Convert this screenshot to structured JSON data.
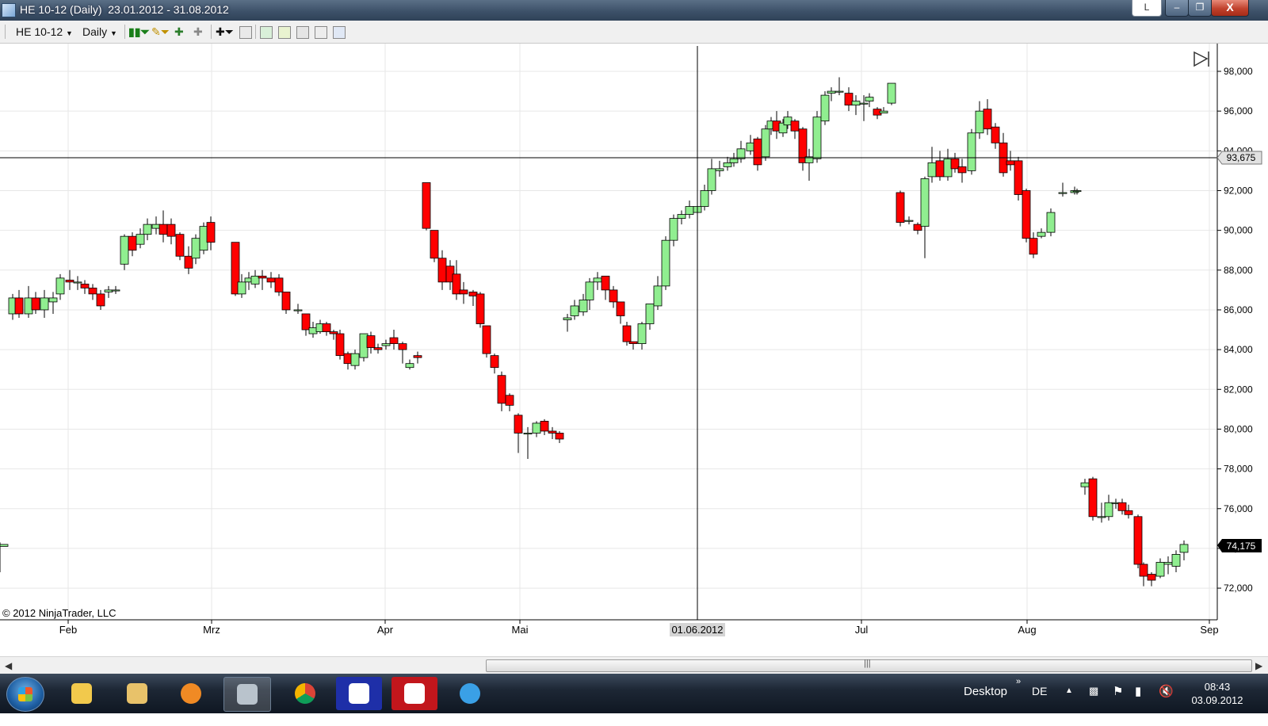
{
  "window": {
    "title": "HE 10-12 (Daily)  23.01.2012 - 31.08.2012",
    "l_button": "L",
    "minimize_label": "–",
    "maximize_label": "❐",
    "close_label": "X"
  },
  "toolbar": {
    "instrument": "HE 10-12",
    "interval": "Daily"
  },
  "chart": {
    "copyright": "© 2012 NinjaTrader, LLC",
    "crosshair_date": "01.06.2012",
    "crosshair_price": "93,675",
    "last_price": "74,175",
    "y_ticks": [
      "98,000",
      "96,000",
      "94,000",
      "92,000",
      "90,000",
      "88,000",
      "86,000",
      "84,000",
      "82,000",
      "80,000",
      "78,000",
      "76,000",
      "74,000",
      "72,000"
    ],
    "x_ticks": [
      "Feb",
      "Mrz",
      "Apr",
      "Mai",
      "Jul",
      "Aug",
      "Sep"
    ],
    "up_color": "#90ee90",
    "down_color": "#ff0000"
  },
  "chart_data": {
    "type": "candlestick",
    "ylim": [
      71.2,
      99.5
    ],
    "candles": [
      [
        85.8,
        86.6,
        85.5,
        86.8
      ],
      [
        86.6,
        85.8,
        85.6,
        87.0
      ],
      [
        85.8,
        86.6,
        85.6,
        87.2
      ],
      [
        86.6,
        86.0,
        85.8,
        86.9
      ],
      [
        86.0,
        86.6,
        85.6,
        87.0
      ],
      [
        86.4,
        86.6,
        85.8,
        86.9
      ],
      [
        86.8,
        87.6,
        86.5,
        87.8
      ],
      [
        87.5,
        87.4,
        87.0,
        88.0
      ],
      [
        87.4,
        87.4,
        87.0,
        87.7
      ],
      [
        87.3,
        87.1,
        86.8,
        87.5
      ],
      [
        87.1,
        86.8,
        86.5,
        87.3
      ],
      [
        86.8,
        86.2,
        86.0,
        87.0
      ],
      [
        86.9,
        87.0,
        86.6,
        87.2
      ],
      [
        87.0,
        87.0,
        86.8,
        87.2
      ],
      [
        88.3,
        89.7,
        88.0,
        89.8
      ],
      [
        89.7,
        89.0,
        88.7,
        89.9
      ],
      [
        89.3,
        89.8,
        89.1,
        90.1
      ],
      [
        89.8,
        90.3,
        89.5,
        90.6
      ],
      [
        90.1,
        90.3,
        89.8,
        90.7
      ],
      [
        90.3,
        89.8,
        89.4,
        91.0
      ],
      [
        90.3,
        89.7,
        89.3,
        90.6
      ],
      [
        89.8,
        88.7,
        88.5,
        89.9
      ],
      [
        88.7,
        88.1,
        87.8,
        89.2
      ],
      [
        88.6,
        89.6,
        88.3,
        89.8
      ],
      [
        89.0,
        90.2,
        88.8,
        90.4
      ],
      [
        90.4,
        89.4,
        89.0,
        90.7
      ],
      [
        89.4,
        86.8,
        86.7,
        89.4
      ],
      [
        86.8,
        87.4,
        86.6,
        87.8
      ],
      [
        87.4,
        87.6,
        87.0,
        87.9
      ],
      [
        87.3,
        87.7,
        87.1,
        88.0
      ],
      [
        87.7,
        87.6,
        87.0,
        88.0
      ],
      [
        87.6,
        87.4,
        87.1,
        87.9
      ],
      [
        87.6,
        86.9,
        86.7,
        87.8
      ],
      [
        86.9,
        86.0,
        85.8,
        86.9
      ],
      [
        86.0,
        86.0,
        85.8,
        86.3
      ],
      [
        85.8,
        85.0,
        84.7,
        85.8
      ],
      [
        84.8,
        85.1,
        84.6,
        85.4
      ],
      [
        84.9,
        85.3,
        84.8,
        85.5
      ],
      [
        85.3,
        84.9,
        84.7,
        85.4
      ],
      [
        84.9,
        84.8,
        84.5,
        85.0
      ],
      [
        84.8,
        83.7,
        83.5,
        85.0
      ],
      [
        83.8,
        83.3,
        83.0,
        83.9
      ],
      [
        83.2,
        83.8,
        83.0,
        84.0
      ],
      [
        83.6,
        84.8,
        83.4,
        84.8
      ],
      [
        84.7,
        84.1,
        83.8,
        84.9
      ],
      [
        84.1,
        84.0,
        83.8,
        84.3
      ],
      [
        84.2,
        84.3,
        84.0,
        84.5
      ],
      [
        84.6,
        84.3,
        84.0,
        85.0
      ],
      [
        84.3,
        84.0,
        83.3,
        84.4
      ],
      [
        83.1,
        83.3,
        83.0,
        83.5
      ],
      [
        83.7,
        83.6,
        83.3,
        83.9
      ],
      [
        92.4,
        90.1,
        90.0,
        92.4
      ],
      [
        90.0,
        88.6,
        88.4,
        90.0
      ],
      [
        88.6,
        87.4,
        87.0,
        89.0
      ],
      [
        88.2,
        87.4,
        87.0,
        88.5
      ],
      [
        87.8,
        86.8,
        86.5,
        88.5
      ],
      [
        87.0,
        86.8,
        86.3,
        87.4
      ],
      [
        86.9,
        86.7,
        86.2,
        87.0
      ],
      [
        86.8,
        85.3,
        85.1,
        86.9
      ],
      [
        85.2,
        83.8,
        83.6,
        85.2
      ],
      [
        83.7,
        83.1,
        82.8,
        83.8
      ],
      [
        82.7,
        81.3,
        80.9,
        82.9
      ],
      [
        81.7,
        81.2,
        80.9,
        81.8
      ],
      [
        80.7,
        79.8,
        78.8,
        80.8
      ],
      [
        79.8,
        79.8,
        78.5,
        80.1
      ],
      [
        79.8,
        80.3,
        79.6,
        80.4
      ],
      [
        80.4,
        79.9,
        79.7,
        80.5
      ],
      [
        79.9,
        79.8,
        79.5,
        80.1
      ],
      [
        79.8,
        79.5,
        79.3,
        79.9
      ],
      [
        85.5,
        85.6,
        84.9,
        85.8
      ],
      [
        85.7,
        86.2,
        85.5,
        86.5
      ],
      [
        85.9,
        86.5,
        85.7,
        86.8
      ],
      [
        86.5,
        87.4,
        86.0,
        87.6
      ],
      [
        87.4,
        87.6,
        87.0,
        87.9
      ],
      [
        87.7,
        87.0,
        86.5,
        87.7
      ],
      [
        87.0,
        86.4,
        86.1,
        87.2
      ],
      [
        86.4,
        85.7,
        85.3,
        86.4
      ],
      [
        85.2,
        84.4,
        84.2,
        85.4
      ],
      [
        84.4,
        84.3,
        84.0,
        84.4
      ],
      [
        84.3,
        85.3,
        84.0,
        85.4
      ],
      [
        85.3,
        86.3,
        85.0,
        86.3
      ],
      [
        86.2,
        87.2,
        86.0,
        87.7
      ],
      [
        87.2,
        89.5,
        87.0,
        89.7
      ],
      [
        89.5,
        90.6,
        89.2,
        90.8
      ],
      [
        90.6,
        90.8,
        90.3,
        91.0
      ],
      [
        90.8,
        91.2,
        90.6,
        91.5
      ],
      [
        90.9,
        91.2,
        90.7,
        91.6
      ],
      [
        91.2,
        92.0,
        91.0,
        92.3
      ],
      [
        92.0,
        93.1,
        91.8,
        93.6
      ],
      [
        93.0,
        93.1,
        92.7,
        93.5
      ],
      [
        93.2,
        93.4,
        93.0,
        93.7
      ],
      [
        93.4,
        93.6,
        93.2,
        93.9
      ],
      [
        93.6,
        94.1,
        93.4,
        94.5
      ],
      [
        94.0,
        94.4,
        93.8,
        94.8
      ],
      [
        94.6,
        93.3,
        93.0,
        94.7
      ],
      [
        93.7,
        95.1,
        93.5,
        95.3
      ],
      [
        95.1,
        95.5,
        94.8,
        95.7
      ],
      [
        95.5,
        95.0,
        94.6,
        96.0
      ],
      [
        94.9,
        95.4,
        94.7,
        95.6
      ],
      [
        95.3,
        95.7,
        95.1,
        96.0
      ],
      [
        95.5,
        95.0,
        94.6,
        95.6
      ],
      [
        95.1,
        93.4,
        93.0,
        95.2
      ],
      [
        93.4,
        93.7,
        92.5,
        94.1
      ],
      [
        93.6,
        95.7,
        93.4,
        96.0
      ],
      [
        95.5,
        96.8,
        95.3,
        97.0
      ],
      [
        96.9,
        97.0,
        96.5,
        97.2
      ],
      [
        97.0,
        97.0,
        96.8,
        97.7
      ],
      [
        96.9,
        96.3,
        96.0,
        97.2
      ],
      [
        96.3,
        96.5,
        95.8,
        96.8
      ],
      [
        96.4,
        96.4,
        95.5,
        96.8
      ],
      [
        96.5,
        96.7,
        96.2,
        96.9
      ],
      [
        96.1,
        95.8,
        95.6,
        96.2
      ],
      [
        95.9,
        96.0,
        95.9,
        96.2
      ],
      [
        96.4,
        97.4,
        96.3,
        97.4
      ],
      [
        91.9,
        90.4,
        90.2,
        92.0
      ],
      [
        90.5,
        90.5,
        90.3,
        90.7
      ],
      [
        90.3,
        90.0,
        89.8,
        90.4
      ],
      [
        90.2,
        92.6,
        88.6,
        92.7
      ],
      [
        92.7,
        93.4,
        92.4,
        94.2
      ],
      [
        93.5,
        92.7,
        92.5,
        94.0
      ],
      [
        92.7,
        93.6,
        92.5,
        94.1
      ],
      [
        93.6,
        93.1,
        92.9,
        93.9
      ],
      [
        93.2,
        92.9,
        92.4,
        93.6
      ],
      [
        93.0,
        94.9,
        92.8,
        95.1
      ],
      [
        94.9,
        96.0,
        94.6,
        96.5
      ],
      [
        96.1,
        95.1,
        94.8,
        96.6
      ],
      [
        95.2,
        94.4,
        94.1,
        95.4
      ],
      [
        94.4,
        92.9,
        92.7,
        94.9
      ],
      [
        93.5,
        93.3,
        93.0,
        94.0
      ],
      [
        93.5,
        91.8,
        91.5,
        93.7
      ],
      [
        92.0,
        89.6,
        89.4,
        92.1
      ],
      [
        89.6,
        88.8,
        88.6,
        89.9
      ],
      [
        89.7,
        89.9,
        89.6,
        90.1
      ],
      [
        89.9,
        90.9,
        89.7,
        91.1
      ],
      [
        91.9,
        91.9,
        91.7,
        92.4
      ],
      [
        91.9,
        92.0,
        91.8,
        92.2
      ],
      [
        92.0,
        92.0,
        91.8,
        92.1
      ],
      [
        77.1,
        77.3,
        76.7,
        77.5
      ],
      [
        77.5,
        75.6,
        75.4,
        77.6
      ],
      [
        75.6,
        75.6,
        75.3,
        76.3
      ],
      [
        75.6,
        76.3,
        75.4,
        76.7
      ],
      [
        76.3,
        76.3,
        76.0,
        76.5
      ],
      [
        76.3,
        75.9,
        75.7,
        76.5
      ],
      [
        75.9,
        75.7,
        75.5,
        76.2
      ],
      [
        75.6,
        73.2,
        73.0,
        75.7
      ],
      [
        73.2,
        72.6,
        72.1,
        73.3
      ],
      [
        72.7,
        72.4,
        72.1,
        72.8
      ],
      [
        72.6,
        73.3,
        72.5,
        73.5
      ],
      [
        73.2,
        73.3,
        72.7,
        73.6
      ],
      [
        73.1,
        73.7,
        72.8,
        73.9
      ],
      [
        73.8,
        74.2,
        73.4,
        74.4
      ],
      [
        74.1,
        74.2,
        72.8,
        74.3
      ]
    ],
    "x_centers": [
      16,
      24,
      36,
      45,
      56,
      67,
      76,
      88,
      98,
      107,
      117,
      127,
      137,
      146,
      157,
      167,
      177,
      186,
      197,
      206,
      216,
      227,
      238,
      247,
      257,
      266,
      297,
      305,
      314,
      322,
      331,
      342,
      352,
      361,
      376,
      386,
      395,
      404,
      412,
      421,
      429,
      439,
      448,
      459,
      468,
      477,
      487,
      497,
      508,
      517,
      527,
      538,
      548,
      558,
      568,
      576,
      585,
      597,
      606,
      614,
      624,
      633,
      643,
      654,
      666,
      677,
      687,
      697,
      706,
      716,
      725,
      736,
      744,
      754,
      764,
      774,
      783,
      791,
      799,
      810,
      820,
      830,
      840,
      850,
      860,
      870,
      880,
      889,
      898,
      908,
      918,
      926,
      935,
      947,
      956,
      966,
      973,
      980,
      988,
      994,
      1003,
      1013,
      1021,
      1031,
      1041,
      1049,
      1059,
      1071,
      1080,
      1090,
      1097,
      1107,
      1115,
      1125,
      1136,
      1147,
      1158,
      1167,
      1176,
      1186,
      1196,
      1205,
      1214,
      1226,
      1236,
      1246,
      1256,
      1266,
      1275,
      1285,
      1295,
      1304,
      1314,
      1326,
      1341,
      1356,
      1359,
      1369,
      1379,
      1390,
      1399,
      1408,
      1416,
      1424,
      1436,
      1443,
      1453,
      1464,
      1474,
      1484,
      1494
    ]
  }
}
